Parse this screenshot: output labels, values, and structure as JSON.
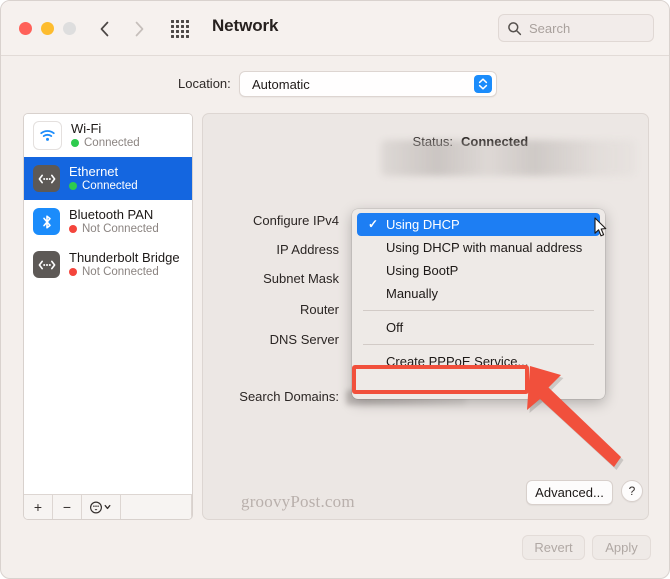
{
  "window": {
    "title": "Network",
    "traffic_lights": [
      "close",
      "minimize",
      "zoom"
    ],
    "nav_back_icon": "chevron-left-icon",
    "nav_forward_icon": "chevron-right-icon",
    "grid_icon": "show-all-grid-icon"
  },
  "search": {
    "placeholder": "Search",
    "icon": "search-icon",
    "value": ""
  },
  "location": {
    "label": "Location:",
    "value": "Automatic",
    "stepper_icon": "chevron-up-down-icon"
  },
  "sidebar": {
    "items": [
      {
        "name": "Wi-Fi",
        "status": "Connected",
        "connected": true,
        "icon": "wifi-icon",
        "selected": false
      },
      {
        "name": "Ethernet",
        "status": "Connected",
        "connected": true,
        "icon": "ethernet-icon",
        "selected": true
      },
      {
        "name": "Bluetooth PAN",
        "status": "Not Connected",
        "connected": false,
        "icon": "bluetooth-icon",
        "selected": false
      },
      {
        "name": "Thunderbolt Bridge",
        "status": "Not Connected",
        "connected": false,
        "icon": "ethernet-icon",
        "selected": false
      }
    ],
    "toolbar": {
      "add_label": "+",
      "remove_label": "−",
      "more_label": "⊙",
      "more_chevron": "chevron-down-icon"
    }
  },
  "main": {
    "status_label": "Status:",
    "status_value": "Connected",
    "fields": [
      {
        "label": "Configure IPv4"
      },
      {
        "label": "IP Address"
      },
      {
        "label": "Subnet Mask"
      },
      {
        "label": "Router"
      },
      {
        "label": "DNS Server"
      },
      {
        "label": "Search Domains:"
      }
    ]
  },
  "dropdown": {
    "items": [
      {
        "label": "Using DHCP",
        "checked": true,
        "selected": true
      },
      {
        "label": "Using DHCP with manual address",
        "checked": false,
        "selected": false
      },
      {
        "label": "Using BootP",
        "checked": false,
        "selected": false
      },
      {
        "label": "Manually",
        "checked": false,
        "selected": false
      },
      {
        "separator": true
      },
      {
        "label": "Off",
        "checked": false,
        "selected": false
      },
      {
        "separator": true
      },
      {
        "label": "Create PPPoE Service...",
        "checked": false,
        "selected": false,
        "highlighted": true
      }
    ],
    "checkmark": "✓"
  },
  "footer": {
    "advanced_label": "Advanced...",
    "help_label": "?",
    "revert_label": "Revert",
    "apply_label": "Apply"
  },
  "annotation": {
    "highlight_color": "#f1503c",
    "arrow_color": "#f1503c",
    "watermark": "groovyPost.com"
  },
  "colors": {
    "accent_blue": "#1466e0",
    "menu_blue": "#1d7ef3",
    "connected_green": "#2ecb4e",
    "disconnected_red": "#f4453c",
    "annotation_red": "#f1503c"
  }
}
